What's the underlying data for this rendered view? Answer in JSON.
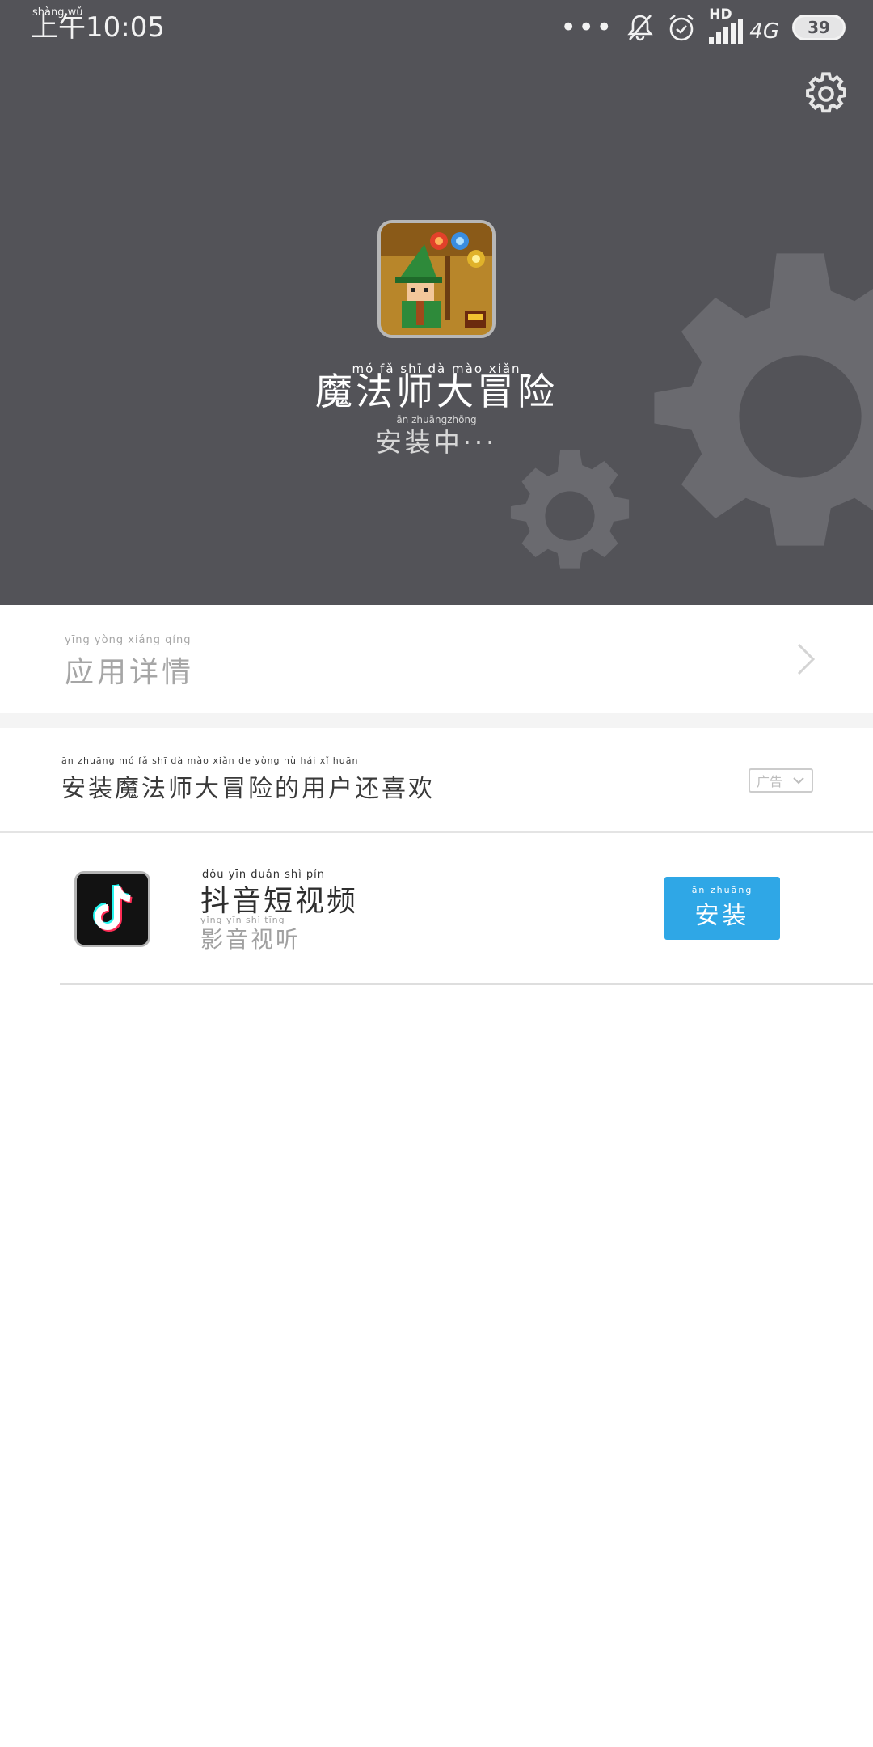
{
  "status_bar": {
    "time": "上午10:05",
    "time_pinyin": "shàng  wǔ",
    "dots": "•••",
    "hd": "HD",
    "network": "4G",
    "battery": "39"
  },
  "app": {
    "name": "魔法师大冒险",
    "name_pinyin": "mó   fǎ   shī   dà   mào  xiǎn",
    "status": "安装中···",
    "status_pinyin": "ān  zhuāngzhōng"
  },
  "details": {
    "label": "应用详情",
    "label_pinyin": "yīng  yòng  xiáng  qíng"
  },
  "recommendations": {
    "title": "安装魔法师大冒险的用户还喜欢",
    "title_pinyin": "ān  zhuāng mó   fǎ   shī   dà   mào  xiǎn   de   yòng   hù   hái   xǐ   huān",
    "ad_label": "广告",
    "items": [
      {
        "name": "抖音短视频",
        "name_pinyin": "dǒu   yīn   duǎn   shì   pín",
        "category": "影音视听",
        "category_pinyin": "yǐng   yīn   shì   tīng",
        "button_label": "安装",
        "button_pinyin": "ān  zhuāng"
      }
    ]
  },
  "colors": {
    "header_bg": "#535358",
    "accent": "#2fa7e6"
  }
}
